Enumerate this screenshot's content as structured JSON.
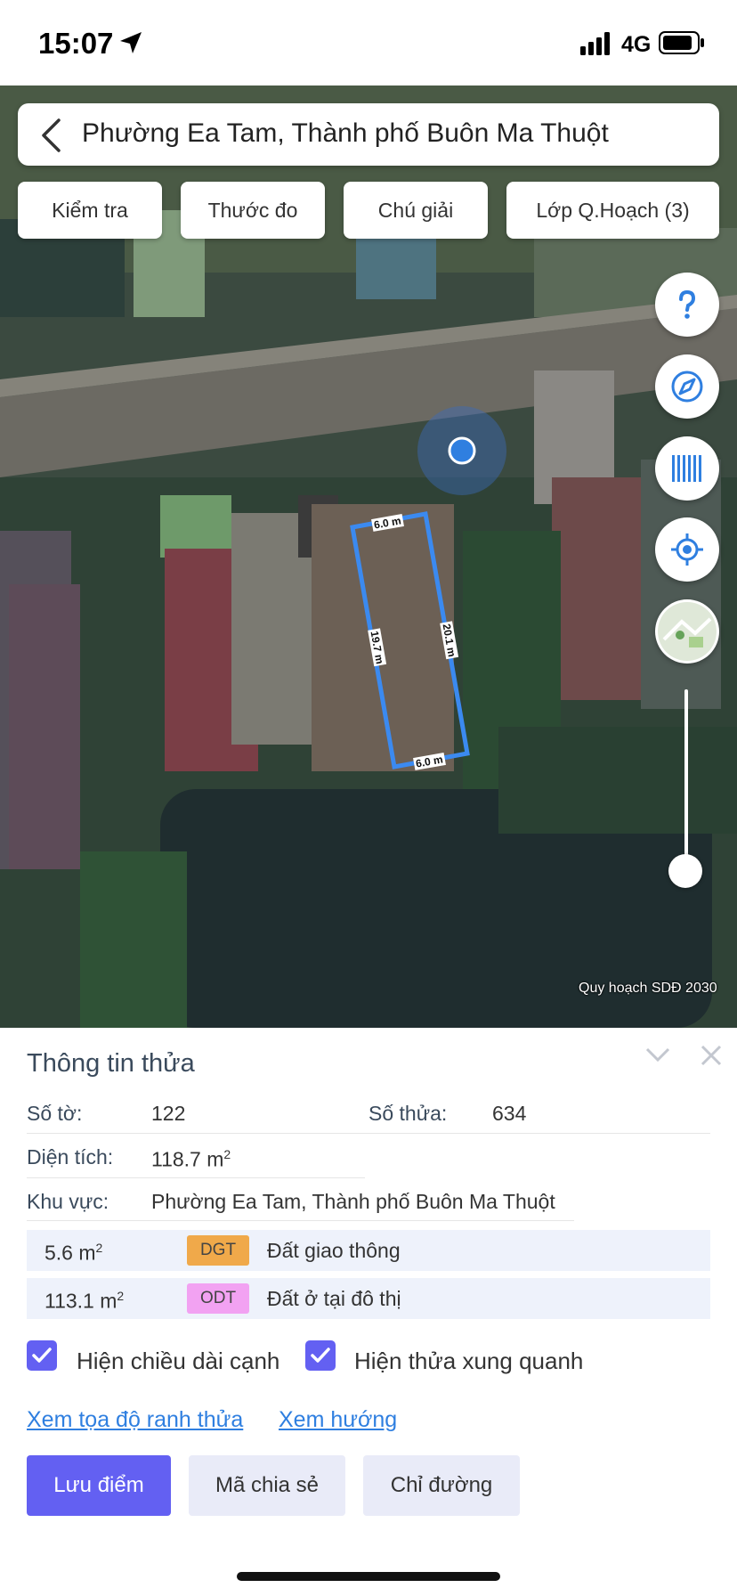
{
  "status_bar": {
    "time": "15:07",
    "network": "4G"
  },
  "search": {
    "location_text": "Phường Ea Tam, Thành phố Buôn Ma Thuột"
  },
  "chips": [
    "Kiểm tra",
    "Thước đo",
    "Chú giải",
    "Lớp Q.Hoạch (3)"
  ],
  "map": {
    "edge_top": "6.0 m",
    "edge_bottom": "6.0 m",
    "edge_left": "19.7 m",
    "edge_right": "20.1 m",
    "caption": "Quy hoạch SDĐ 2030",
    "slider_level": 0
  },
  "panel": {
    "title": "Thông tin thửa",
    "so_to_label": "Số tờ:",
    "so_to_value": "122",
    "so_thua_label": "Số thửa:",
    "so_thua_value": "634",
    "dien_tich_label": "Diện tích:",
    "dien_tich_value": "118.7 m",
    "dien_tich_unit_sup": "2",
    "khu_vuc_label": "Khu vực:",
    "khu_vuc_value": "Phường Ea Tam, Thành phố Buôn Ma Thuột",
    "land_uses": [
      {
        "area": "5.6 m",
        "sup": "2",
        "code": "DGT",
        "code_color": "#f0a94a",
        "desc": "Đất giao thông"
      },
      {
        "area": "113.1 m",
        "sup": "2",
        "code": "ODT",
        "code_color": "#f2a2f2",
        "desc": "Đất ở tại đô thị"
      }
    ],
    "checkbox_edge_length": "Hiện chiều dài cạnh",
    "checkbox_surrounding": "Hiện thửa xung quanh",
    "link_coordinates": "Xem tọa độ ranh thửa",
    "link_direction": "Xem hướng",
    "btn_save": "Lưu điểm",
    "btn_share": "Mã chia sẻ",
    "btn_directions": "Chỉ đường"
  },
  "colors": {
    "accent": "#6360f2",
    "parcel_outline": "#3b8af0",
    "link": "#2f7fe0"
  }
}
